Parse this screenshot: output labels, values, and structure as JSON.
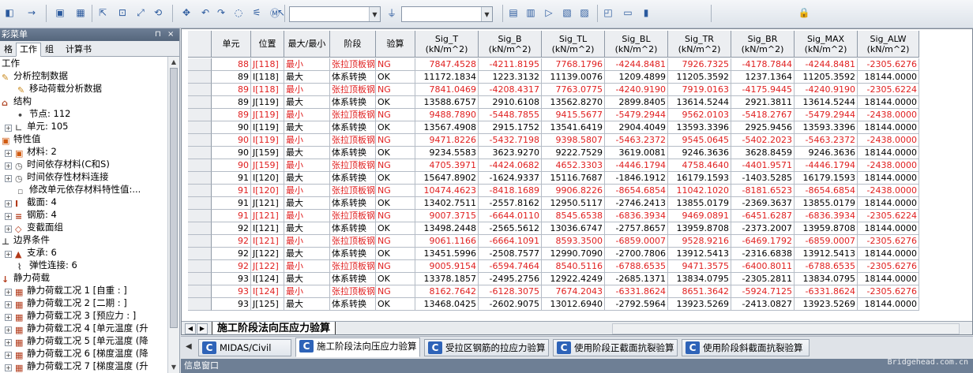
{
  "toolbar": {
    "icons": [
      "snap-icon",
      "nav-icon",
      "save-icon",
      "grid-icon",
      "select-icon",
      "zoom-window-icon",
      "zoom-fit-icon",
      "rotate-icon",
      "pan-icon",
      "undo-icon",
      "redo-icon",
      "node-icon",
      "element-icon",
      "midas-icon",
      "pointer-icon",
      "filter-icon",
      "display-icon",
      "table-icon",
      "chart-icon",
      "results-icon",
      "view-icon",
      "window-icon",
      "monitor-icon",
      "graph-icon",
      "lock-icon"
    ]
  },
  "left_panel": {
    "title": "彩菜单",
    "tabs": [
      "格",
      "工作",
      "组",
      "计算书"
    ],
    "active_tab": "工作",
    "tree": [
      {
        "label": "工作",
        "level": 0,
        "icon": "none"
      },
      {
        "label": "分析控制数据",
        "level": 0,
        "icon": "edit-icon"
      },
      {
        "label": "移动荷载分析数据",
        "level": 1,
        "icon": "edit-icon"
      },
      {
        "label": "结构",
        "level": 0,
        "icon": "structure-icon"
      },
      {
        "label": "节点: 112",
        "level": 1,
        "icon": "node-icon"
      },
      {
        "label": "单元: 105",
        "level": 1,
        "icon": "element-icon",
        "expand": true
      },
      {
        "label": "特性值",
        "level": 0,
        "icon": "property-icon"
      },
      {
        "label": "材料: 2",
        "level": 1,
        "icon": "material-icon",
        "expand": true
      },
      {
        "label": "时间依存材料(C和S)",
        "level": 1,
        "icon": "time-icon",
        "expand": true
      },
      {
        "label": "时间依存性材料连接",
        "level": 1,
        "icon": "time-icon",
        "expand": true
      },
      {
        "label": "修改单元依存材料特性值:...",
        "level": 1,
        "icon": "modify-icon"
      },
      {
        "label": "截面: 4",
        "level": 1,
        "icon": "section-icon",
        "expand": true
      },
      {
        "label": "钢筋: 4",
        "level": 1,
        "icon": "rebar-icon",
        "expand": true
      },
      {
        "label": "变截面组",
        "level": 1,
        "icon": "tapered-icon",
        "expand": true
      },
      {
        "label": "边界条件",
        "level": 0,
        "icon": "boundary-icon"
      },
      {
        "label": "支承: 6",
        "level": 1,
        "icon": "support-icon",
        "expand": true
      },
      {
        "label": "弹性连接: 6",
        "level": 1,
        "icon": "spring-icon"
      },
      {
        "label": "静力荷载",
        "level": 0,
        "icon": "load-icon"
      },
      {
        "label": "静力荷载工况 1 [自重 : ]",
        "level": 1,
        "icon": "loadcase-icon",
        "expand": true
      },
      {
        "label": "静力荷载工况 2 [二期 : ]",
        "level": 1,
        "icon": "loadcase-icon",
        "expand": true
      },
      {
        "label": "静力荷载工况 3 [预应力 : ]",
        "level": 1,
        "icon": "loadcase-icon",
        "expand": true
      },
      {
        "label": "静力荷载工况 4 [单元温度 (升",
        "level": 1,
        "icon": "loadcase-icon",
        "expand": true
      },
      {
        "label": "静力荷载工况 5 [单元温度 (降",
        "level": 1,
        "icon": "loadcase-icon",
        "expand": true
      },
      {
        "label": "静力荷载工况 6 [梯度温度 (降",
        "level": 1,
        "icon": "loadcase-icon",
        "expand": true
      },
      {
        "label": "静力荷载工况 7 [梯度温度 (升",
        "level": 1,
        "icon": "loadcase-icon",
        "expand": true
      }
    ]
  },
  "table": {
    "columns": [
      {
        "key": "unit",
        "label": "单元",
        "sub": ""
      },
      {
        "key": "pos",
        "label": "位置",
        "sub": ""
      },
      {
        "key": "mm",
        "label": "最大/最小",
        "sub": ""
      },
      {
        "key": "stage",
        "label": "阶段",
        "sub": ""
      },
      {
        "key": "check",
        "label": "验算",
        "sub": ""
      },
      {
        "key": "sig_t",
        "label": "Sig_T",
        "sub": "(kN/m^2)"
      },
      {
        "key": "sig_b",
        "label": "Sig_B",
        "sub": "(kN/m^2)"
      },
      {
        "key": "sig_tl",
        "label": "Sig_TL",
        "sub": "(kN/m^2)"
      },
      {
        "key": "sig_bl",
        "label": "Sig_BL",
        "sub": "(kN/m^2)"
      },
      {
        "key": "sig_tr",
        "label": "Sig_TR",
        "sub": "(kN/m^2)"
      },
      {
        "key": "sig_br",
        "label": "Sig_BR",
        "sub": "(kN/m^2)"
      },
      {
        "key": "sig_max",
        "label": "Sig_MAX",
        "sub": "(kN/m^2)"
      },
      {
        "key": "sig_alw",
        "label": "Sig_ALW",
        "sub": "(kN/m^2)"
      }
    ],
    "rows": [
      [
        "88",
        "J[118]",
        "最小",
        "张拉顶板钢",
        "NG",
        "7847.4528",
        "-4211.8195",
        "7768.1796",
        "-4244.8481",
        "7926.7325",
        "-4178.7844",
        "-4244.8481",
        "-2305.6276"
      ],
      [
        "89",
        "I[118]",
        "最大",
        "体系转换",
        "OK",
        "11172.1834",
        "1223.3132",
        "11139.0076",
        "1209.4899",
        "11205.3592",
        "1237.1364",
        "11205.3592",
        "18144.0000"
      ],
      [
        "89",
        "I[118]",
        "最小",
        "张拉顶板钢",
        "NG",
        "7841.0469",
        "-4208.4317",
        "7763.0775",
        "-4240.9190",
        "7919.0163",
        "-4175.9445",
        "-4240.9190",
        "-2305.6224"
      ],
      [
        "89",
        "J[119]",
        "最大",
        "体系转换",
        "OK",
        "13588.6757",
        "2910.6108",
        "13562.8270",
        "2899.8405",
        "13614.5244",
        "2921.3811",
        "13614.5244",
        "18144.0000"
      ],
      [
        "89",
        "J[119]",
        "最小",
        "张拉顶板钢",
        "NG",
        "9488.7890",
        "-5448.7855",
        "9415.5677",
        "-5479.2944",
        "9562.0103",
        "-5418.2767",
        "-5479.2944",
        "-2438.0000"
      ],
      [
        "90",
        "I[119]",
        "最大",
        "体系转换",
        "OK",
        "13567.4908",
        "2915.1752",
        "13541.6419",
        "2904.4049",
        "13593.3396",
        "2925.9456",
        "13593.3396",
        "18144.0000"
      ],
      [
        "90",
        "I[119]",
        "最小",
        "张拉顶板钢",
        "NG",
        "9471.8226",
        "-5432.7198",
        "9398.5807",
        "-5463.2372",
        "9545.0645",
        "-5402.2023",
        "-5463.2372",
        "-2438.0000"
      ],
      [
        "90",
        "J[159]",
        "最大",
        "体系转换",
        "OK",
        "9234.5583",
        "3623.9270",
        "9222.7529",
        "3619.0081",
        "9246.3636",
        "3628.8459",
        "9246.3636",
        "18144.0000"
      ],
      [
        "90",
        "J[159]",
        "最小",
        "张拉顶板钢",
        "NG",
        "4705.3971",
        "-4424.0682",
        "4652.3303",
        "-4446.1794",
        "4758.4640",
        "-4401.9571",
        "-4446.1794",
        "-2438.0000"
      ],
      [
        "91",
        "I[120]",
        "最大",
        "体系转换",
        "OK",
        "15647.8902",
        "-1624.9337",
        "15116.7687",
        "-1846.1912",
        "16179.1593",
        "-1403.5285",
        "16179.1593",
        "18144.0000"
      ],
      [
        "91",
        "I[120]",
        "最小",
        "张拉顶板钢",
        "NG",
        "10474.4623",
        "-8418.1689",
        "9906.8226",
        "-8654.6854",
        "11042.1020",
        "-8181.6523",
        "-8654.6854",
        "-2438.0000"
      ],
      [
        "91",
        "J[121]",
        "最大",
        "体系转换",
        "OK",
        "13402.7511",
        "-2557.8162",
        "12950.5117",
        "-2746.2413",
        "13855.0179",
        "-2369.3637",
        "13855.0179",
        "18144.0000"
      ],
      [
        "91",
        "J[121]",
        "最小",
        "张拉顶板钢",
        "NG",
        "9007.3715",
        "-6644.0110",
        "8545.6538",
        "-6836.3934",
        "9469.0891",
        "-6451.6287",
        "-6836.3934",
        "-2305.6224"
      ],
      [
        "92",
        "I[121]",
        "最大",
        "体系转换",
        "OK",
        "13498.2448",
        "-2565.5612",
        "13036.6747",
        "-2757.8657",
        "13959.8708",
        "-2373.2007",
        "13959.8708",
        "18144.0000"
      ],
      [
        "92",
        "I[121]",
        "最小",
        "张拉顶板钢",
        "NG",
        "9061.1166",
        "-6664.1091",
        "8593.3500",
        "-6859.0007",
        "9528.9216",
        "-6469.1792",
        "-6859.0007",
        "-2305.6276"
      ],
      [
        "92",
        "J[122]",
        "最大",
        "体系转换",
        "OK",
        "13451.5996",
        "-2508.7577",
        "12990.7090",
        "-2700.7806",
        "13912.5413",
        "-2316.6838",
        "13912.5413",
        "18144.0000"
      ],
      [
        "92",
        "J[122]",
        "最小",
        "张拉顶板钢",
        "NG",
        "9005.9154",
        "-6594.7464",
        "8540.5116",
        "-6788.6535",
        "9471.3575",
        "-6400.8011",
        "-6788.6535",
        "-2305.6276"
      ],
      [
        "93",
        "I[124]",
        "最大",
        "体系转换",
        "OK",
        "13378.1857",
        "-2495.2756",
        "12922.4249",
        "-2685.1371",
        "13834.0795",
        "-2305.2811",
        "13834.0795",
        "18144.0000"
      ],
      [
        "93",
        "I[124]",
        "最小",
        "张拉顶板钢",
        "NG",
        "8162.7642",
        "-6128.3075",
        "7674.2043",
        "-6331.8624",
        "8651.3642",
        "-5924.7125",
        "-6331.8624",
        "-2305.6276"
      ],
      [
        "93",
        "J[125]",
        "最大",
        "体系转换",
        "OK",
        "13468.0425",
        "-2602.9075",
        "13012.6940",
        "-2792.5964",
        "13923.5269",
        "-2413.0827",
        "13923.5269",
        "18144.0000"
      ],
      [
        "93",
        "J[125]",
        "最小",
        "张拉顶板钢",
        "NG",
        "8249.8652",
        "-6236.0292",
        "7760.6732",
        "-6439.8475",
        "8739.0974",
        "-6032.1707",
        "-6439.8475",
        "-2305.6276"
      ]
    ]
  },
  "sheet_tab": "施工阶段法向压应力验算",
  "doc_tabs": [
    {
      "label": "MIDAS/Civil",
      "active": false
    },
    {
      "label": "施工阶段法向压应力验算",
      "active": true
    },
    {
      "label": "受拉区钢筋的拉应力验算",
      "active": false
    },
    {
      "label": "使用阶段正截面抗裂验算",
      "active": false
    },
    {
      "label": "使用阶段斜截面抗裂验算",
      "active": false
    }
  ],
  "bottom": {
    "title": "信息窗口"
  },
  "watermark": "Bridgehead.com.cn"
}
